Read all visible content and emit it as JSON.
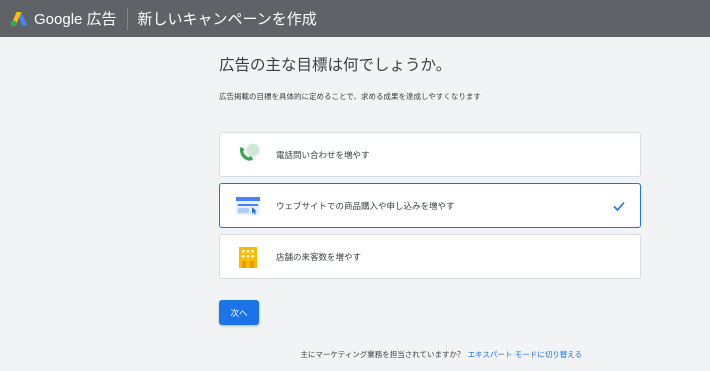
{
  "header": {
    "brand": "Google 広告",
    "title": "新しいキャンペーンを作成",
    "icon": "google-ads-logo-icon"
  },
  "main": {
    "heading": "広告の主な目標は何でしょうか。",
    "subtext": "広告掲載の目標を具体的に定めることで、求める成果を達成しやすくなります",
    "goals": [
      {
        "label": "電話問い合わせを増やす",
        "icon": "phone-icon",
        "selected": false
      },
      {
        "label": "ウェブサイトでの商品購入や申し込みを増やす",
        "icon": "website-icon",
        "selected": true
      },
      {
        "label": "店舗の来客数を増やす",
        "icon": "storefront-icon",
        "selected": false
      }
    ],
    "next_label": "次へ"
  },
  "footer": {
    "question": "主にマーケティング業務を担当されていますか？",
    "link": "エキスパート モードに切り替える"
  },
  "colors": {
    "topbar": "#5f6368",
    "accent": "#1a73e8",
    "background": "#f1f3f4"
  }
}
